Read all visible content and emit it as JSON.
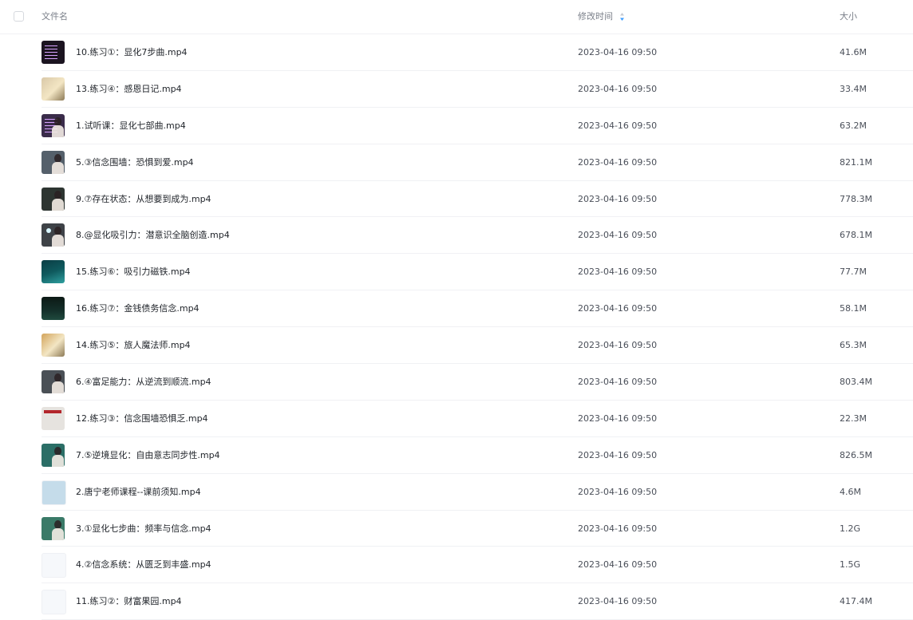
{
  "header": {
    "name_label": "文件名",
    "time_label": "修改时间",
    "size_label": "大小"
  },
  "sort_color": "#3b9cff",
  "files": [
    {
      "name": "10.练习①：显化7步曲.mp4",
      "time": "2023-04-16 09:50",
      "size": "41.6M",
      "thumb_bg": "#1b1420",
      "thumb": "lines"
    },
    {
      "name": "13.练习④：感恩日记.mp4",
      "time": "2023-04-16 09:50",
      "size": "33.4M",
      "thumb_bg": "#d9c8a8",
      "thumb": "warm"
    },
    {
      "name": "1.试听课：显化七部曲.mp4",
      "time": "2023-04-16 09:50",
      "size": "63.2M",
      "thumb_bg": "#3a2c4a",
      "thumb": "lines-person"
    },
    {
      "name": "5.③信念围墙：恐惧到爱.mp4",
      "time": "2023-04-16 09:50",
      "size": "821.1M",
      "thumb_bg": "#55606b",
      "thumb": "person"
    },
    {
      "name": "9.⑦存在状态：从想要到成为.mp4",
      "time": "2023-04-16 09:50",
      "size": "778.3M",
      "thumb_bg": "#2d3531",
      "thumb": "person"
    },
    {
      "name": "8.@显化吸引力：潜意识全脑创造.mp4",
      "time": "2023-04-16 09:50",
      "size": "678.1M",
      "thumb_bg": "#3e4247",
      "thumb": "light-person"
    },
    {
      "name": "15.练习⑥：吸引力磁铁.mp4",
      "time": "2023-04-16 09:50",
      "size": "77.7M",
      "thumb_bg": "#0f5a5e",
      "thumb": "teal"
    },
    {
      "name": "16.练习⑦：金钱债务信念.mp4",
      "time": "2023-04-16 09:50",
      "size": "58.1M",
      "thumb_bg": "#14302a",
      "thumb": "dark"
    },
    {
      "name": "14.练习⑤：旅人魔法师.mp4",
      "time": "2023-04-16 09:50",
      "size": "65.3M",
      "thumb_bg": "#d3a45b",
      "thumb": "warm"
    },
    {
      "name": "6.④富足能力：从逆流到顺流.mp4",
      "time": "2023-04-16 09:50",
      "size": "803.4M",
      "thumb_bg": "#4a5056",
      "thumb": "person"
    },
    {
      "name": "12.练习③：信念围墙恐惧乏.mp4",
      "time": "2023-04-16 09:50",
      "size": "22.3M",
      "thumb_bg": "#e6e3df",
      "thumb": "redbar"
    },
    {
      "name": "7.⑤逆境显化：自由意志同步性.mp4",
      "time": "2023-04-16 09:50",
      "size": "826.5M",
      "thumb_bg": "#2b6e66",
      "thumb": "person"
    },
    {
      "name": "2.唐宁老师课程--课前须知.mp4",
      "time": "2023-04-16 09:50",
      "size": "4.6M",
      "thumb_bg": "#c5dcea",
      "thumb": "plain"
    },
    {
      "name": "3.①显化七步曲：频率与信念.mp4",
      "time": "2023-04-16 09:50",
      "size": "1.2G",
      "thumb_bg": "#3a7a68",
      "thumb": "person"
    },
    {
      "name": "4.②信念系统：从匮乏到丰盛.mp4",
      "time": "2023-04-16 09:50",
      "size": "1.5G",
      "thumb_bg": "#f6f8fb",
      "thumb": "plain"
    },
    {
      "name": "11.练习②：财富果园.mp4",
      "time": "2023-04-16 09:50",
      "size": "417.4M",
      "thumb_bg": "#f6f8fb",
      "thumb": "plain"
    }
  ]
}
